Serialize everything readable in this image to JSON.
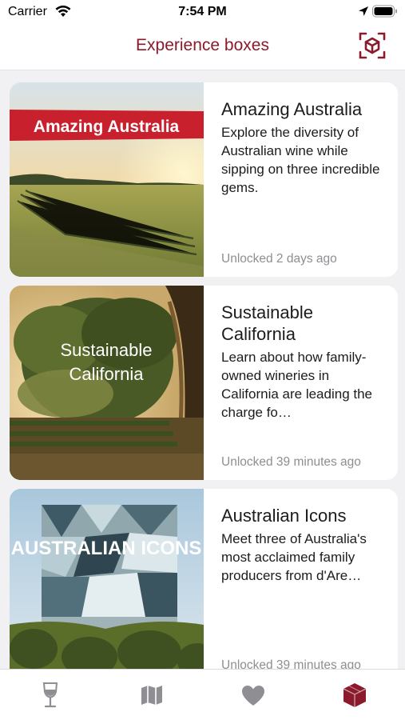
{
  "status_bar": {
    "carrier": "Carrier",
    "time": "7:54 PM"
  },
  "nav": {
    "title": "Experience boxes",
    "ar_icon": "ar-cube-scan-icon"
  },
  "boxes": [
    {
      "name": "Amazing Australia",
      "image_caption": "Amazing Australia",
      "description": "Explore the diversity of Australian wine while sipping on three incredible gems.",
      "unlocked": "Unlocked 2 days ago"
    },
    {
      "name": "Sustainable California",
      "image_caption": "Sustainable California",
      "description": "Learn about how family-owned wineries in California are leading the charge fo…",
      "unlocked": "Unlocked 39 minutes ago"
    },
    {
      "name": "Australian Icons",
      "image_caption": "AUSTRALIAN ICONS",
      "description": "Meet three of Australia's most acclaimed family producers from d'Are…",
      "unlocked": "Unlocked 39 minutes ago"
    }
  ],
  "tabs": [
    {
      "icon": "wine-glass-icon",
      "active": false
    },
    {
      "icon": "map-icon",
      "active": false
    },
    {
      "icon": "heart-icon",
      "active": false
    },
    {
      "icon": "box-icon",
      "active": true
    }
  ],
  "colors": {
    "accent": "#8a1a2c",
    "inactive": "#8e8e93",
    "background": "#f1f1f3"
  }
}
